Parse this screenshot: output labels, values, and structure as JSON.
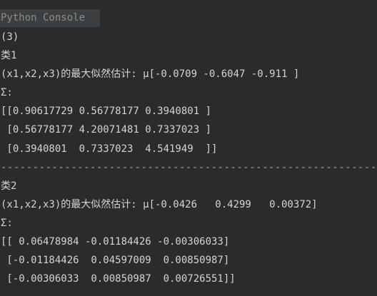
{
  "console": {
    "tab_title": "Python Console",
    "lines": [
      "(3)",
      "类1",
      "(x1,x2,x3)的最大似然估计: μ[-0.0709 -0.6047 -0.911 ]",
      "Σ:",
      "[[0.90617729 0.56778177 0.3940801 ]",
      " [0.56778177 4.20071481 0.7337023 ]",
      " [0.3940801  0.7337023  4.541949  ]]",
      "-----------------------------------------------------------",
      "类2",
      "(x1,x2,x3)的最大似然估计: μ[-0.0426   0.4299   0.00372]",
      "Σ:",
      "[[ 0.06478984 -0.01184426 -0.00306033]",
      " [-0.01184426  0.04597009  0.00850987]",
      " [-0.00306033  0.00850987  0.00726551]]"
    ]
  }
}
